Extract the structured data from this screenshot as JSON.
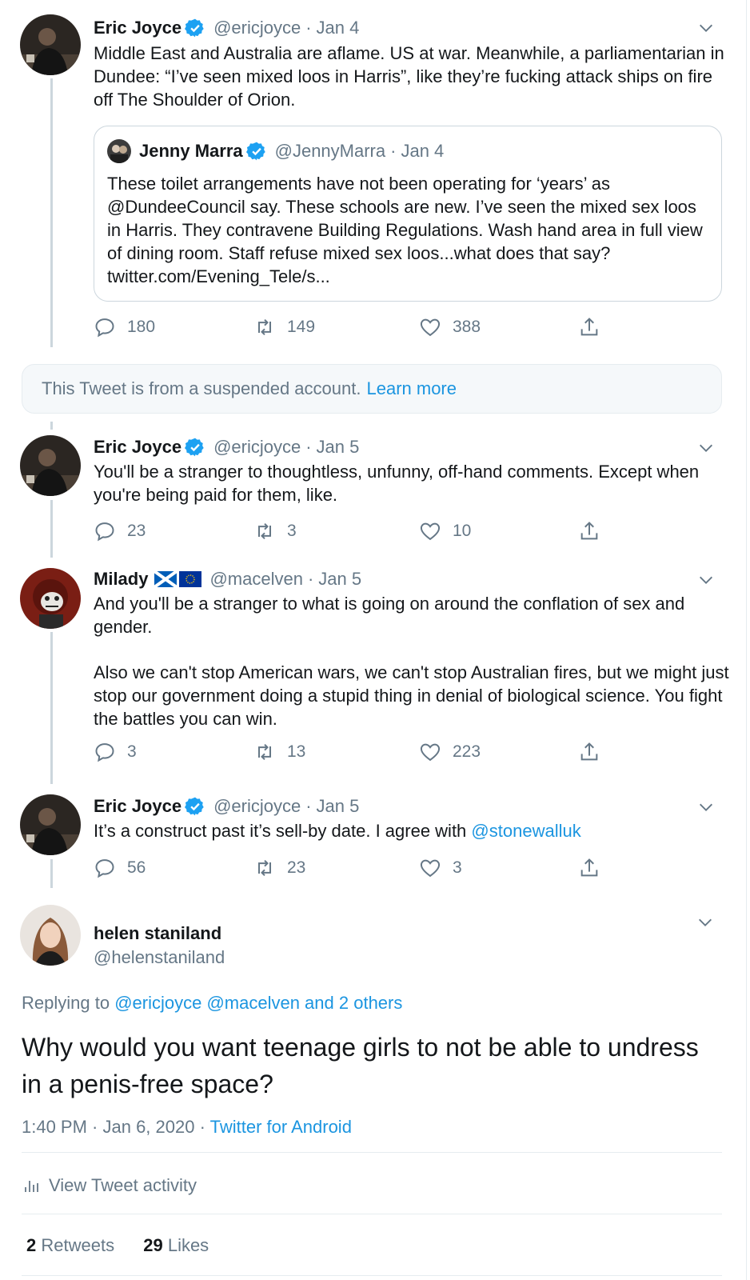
{
  "colors": {
    "link": "#1b95e0",
    "muted": "#657786",
    "text": "#14171a",
    "verified": "#1da1f2",
    "border": "#e6ecf0"
  },
  "tweets": [
    {
      "name": "Eric Joyce",
      "handle": "@ericjoyce",
      "dot": "·",
      "date": "Jan 4",
      "verified": true,
      "text": "Middle East and Australia are aflame. US at war. Meanwhile, a parliamentarian in Dundee: “I’ve seen mixed loos in Harris”, like they’re fucking attack ships on fire off The Shoulder of Orion.",
      "quote": {
        "name": "Jenny Marra",
        "handle": "@JennyMarra",
        "dot": "·",
        "date": "Jan 4",
        "text": "These toilet arrangements have not been operating for ‘years’ as @DundeeCouncil say. These schools are new. I’ve seen the mixed sex loos in Harris. They contravene Building Regulations. Wash hand area in full view of dining room. Staff refuse mixed sex loos...what does that say? twitter.com/Evening_Tele/s..."
      },
      "replies": "180",
      "retweets": "149",
      "likes": "388"
    },
    {
      "suspended_text": "This Tweet is from a suspended account.",
      "learn_more": "Learn more"
    },
    {
      "name": "Eric Joyce",
      "handle": "@ericjoyce",
      "dot": "·",
      "date": "Jan 5",
      "verified": true,
      "text": "You'll be a stranger to thoughtless, unfunny, off-hand comments. Except when you're being paid for them, like.",
      "replies": "23",
      "retweets": "3",
      "likes": "10"
    },
    {
      "name": "Milady",
      "handle": "@macelven",
      "dot": "·",
      "date": "Jan 5",
      "flags": [
        "scotland-flag-icon",
        "eu-flag-icon"
      ],
      "text_p1": "And you'll be a stranger to what is going on around the conflation of sex and gender.",
      "text_p2": "Also we can't stop American wars, we can't stop Australian fires, but we might just stop our government doing a stupid thing in denial of biological science. You fight the battles you can win.",
      "replies": "3",
      "retweets": "13",
      "likes": "223"
    },
    {
      "name": "Eric Joyce",
      "handle": "@ericjoyce",
      "dot": "·",
      "date": "Jan 5",
      "verified": true,
      "text": "It’s a construct past it’s sell-by date. I agree with",
      "mention": "@stonewalluk",
      "replies": "56",
      "retweets": "23",
      "likes": "3"
    }
  ],
  "main": {
    "name": "helen staniland",
    "handle": "@helenstaniland",
    "replying_prefix": "Replying to",
    "replying_to": "@ericjoyce @macelven and 2 others",
    "text": "Why would you want teenage girls to not be able to undress in a penis-free space?",
    "time": "1:40 PM · Jan 6, 2020 ·",
    "source": "Twitter for Android",
    "activity": "View Tweet activity",
    "retweets_count": "2",
    "retweets_label": "Retweets",
    "likes_count": "29",
    "likes_label": "Likes"
  }
}
